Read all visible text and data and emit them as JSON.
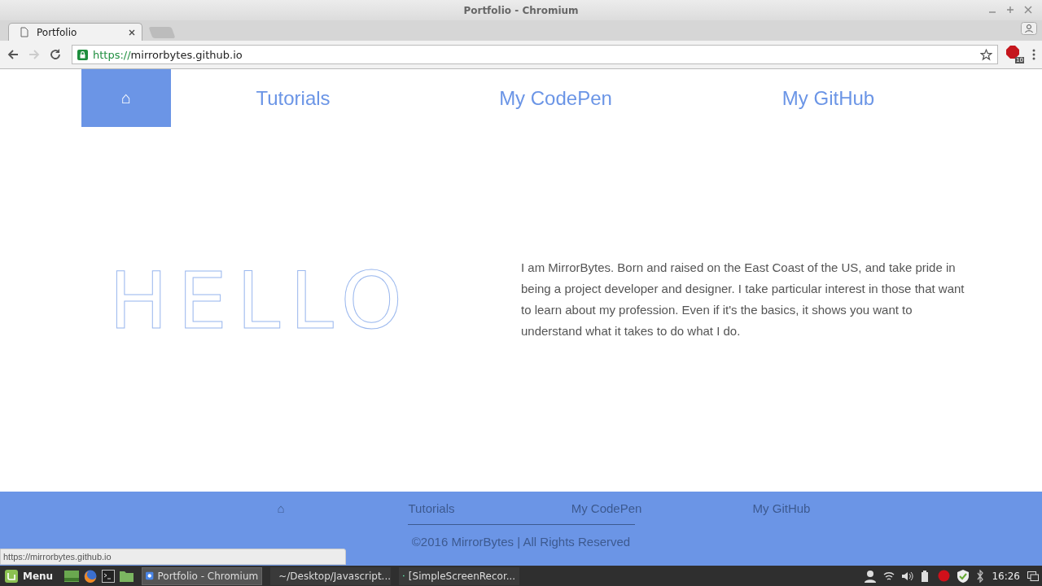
{
  "window": {
    "title": "Portfolio - Chromium"
  },
  "tabs": [
    {
      "label": "Portfolio",
      "selected": true
    }
  ],
  "address_bar": {
    "scheme": "https://",
    "host": "mirrorbytes.github.io"
  },
  "extension_badge": "10",
  "nav": [
    {
      "label": "⌂",
      "selected": true
    },
    {
      "label": "Tutorials",
      "selected": false
    },
    {
      "label": "My CodePen",
      "selected": false
    },
    {
      "label": "My GitHub",
      "selected": false
    }
  ],
  "hello": "HELLO",
  "about": "I am MirrorBytes. Born and raised on the East Coast of the US, and take pride in being a project developer and designer. I take particular interest in those that want to learn about my profession. Even if it's the basics, it shows you want to understand what it takes to do what I do.",
  "footer": {
    "nav": [
      "⌂",
      "Tutorials",
      "My CodePen",
      "My GitHub"
    ],
    "copyright": "©2016 MirrorBytes | All Rights Reserved"
  },
  "status_url": "https://mirrorbytes.github.io",
  "taskbar": {
    "menu": "Menu",
    "windows": [
      {
        "label": "Portfolio - Chromium",
        "selected": true
      },
      {
        "label": "~/Desktop/Javascript...",
        "selected": false
      },
      {
        "label": "[SimpleScreenRecor...",
        "selected": false
      }
    ],
    "clock": "16:26"
  }
}
